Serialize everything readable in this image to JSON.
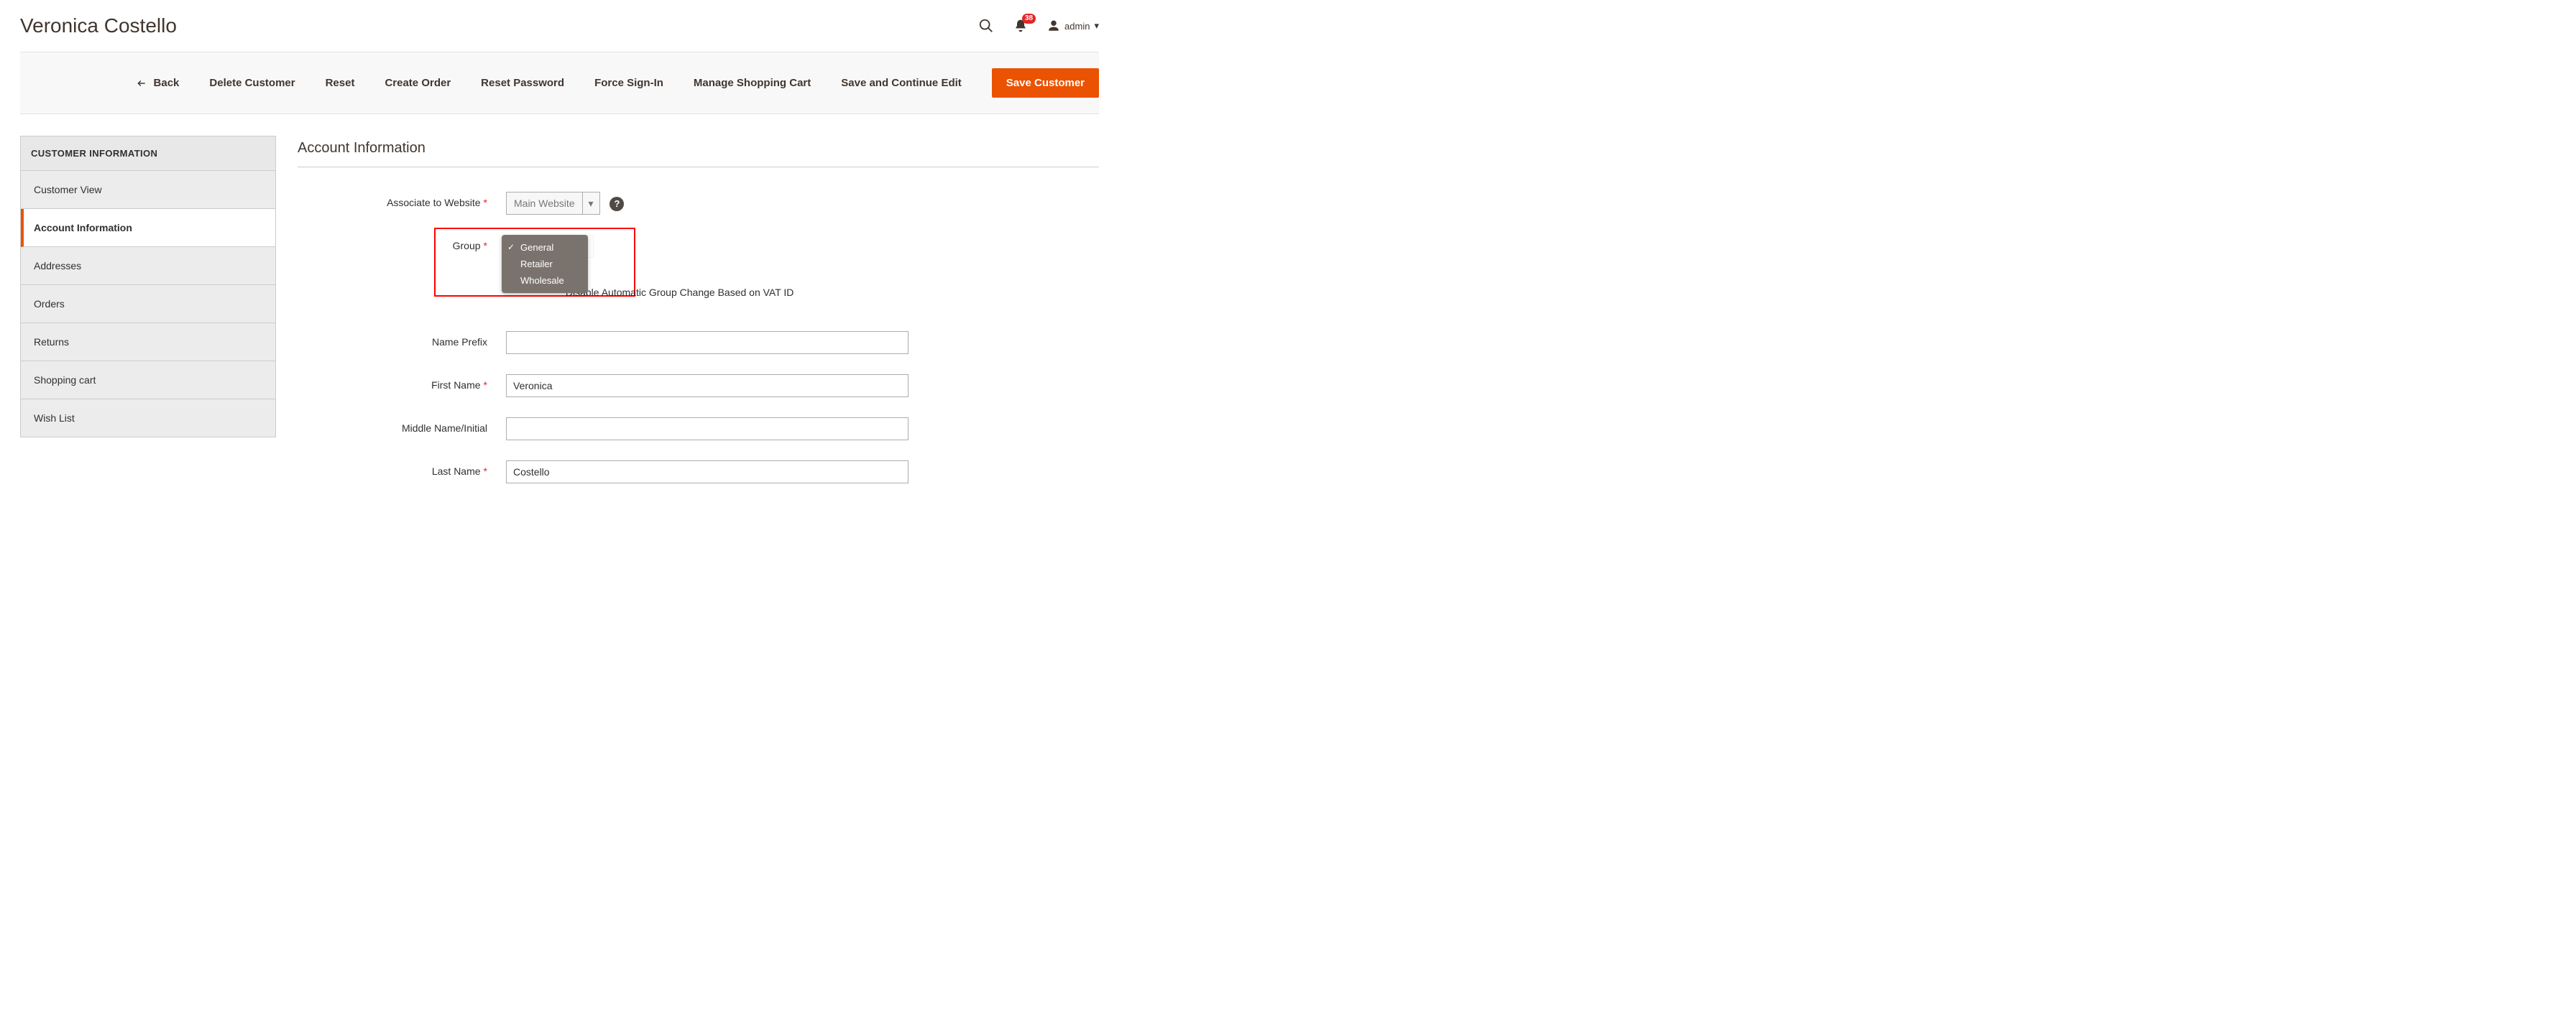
{
  "page_title": "Veronica Costello",
  "notifications_count": "38",
  "admin_label": "admin",
  "actions": {
    "back": "Back",
    "delete": "Delete Customer",
    "reset": "Reset",
    "create_order": "Create Order",
    "reset_password": "Reset Password",
    "force_signin": "Force Sign-In",
    "manage_cart": "Manage Shopping Cart",
    "save_continue": "Save and Continue Edit",
    "save": "Save Customer"
  },
  "sidebar": {
    "title": "CUSTOMER INFORMATION",
    "items": [
      "Customer View",
      "Account Information",
      "Addresses",
      "Orders",
      "Returns",
      "Shopping cart",
      "Wish List"
    ],
    "active_index": 1
  },
  "section_title": "Account Information",
  "form": {
    "associate_label": "Associate to Website",
    "associate_value": "Main Website",
    "group_label": "Group",
    "group_value": "General",
    "group_options": [
      "General",
      "Retailer",
      "Wholesale"
    ],
    "group_checkbox_label": "Disable Automatic Group Change Based on VAT ID",
    "name_prefix_label": "Name Prefix",
    "name_prefix_value": "",
    "first_name_label": "First Name",
    "first_name_value": "Veronica",
    "middle_name_label": "Middle Name/Initial",
    "middle_name_value": "",
    "last_name_label": "Last Name",
    "last_name_value": "Costello"
  }
}
